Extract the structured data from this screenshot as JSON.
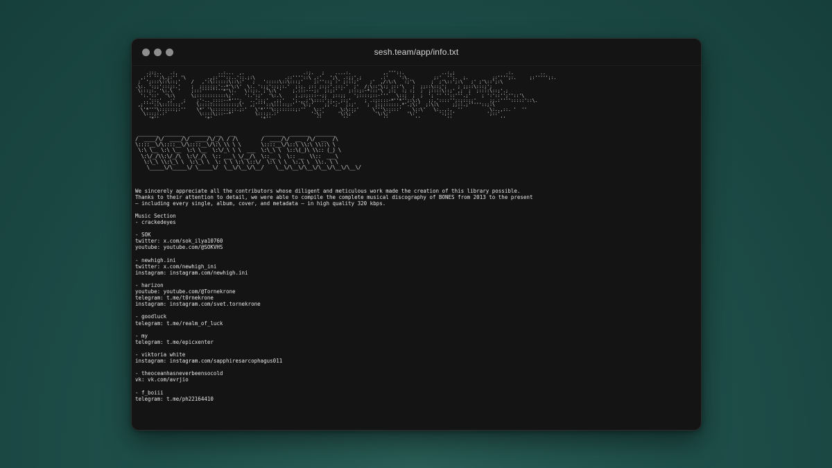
{
  "window": {
    "title": "sesh.team/app/info.txt"
  },
  "ascii_art": {
    "logo_lines": [
      "    .;:;..   .:,               ..:...  ,.                      .:;.   ;    ....:.            ,.'''::.              ..:,;                   .:.          ..",
      "  ,:'' '':\\.;:'' '\\        .,;:'''::..'::.;:\\           .::''''::\\ ,:'   ';\\  .:;;'.;       .:'    ':\\.         ;:'  '':.  ;.         ;:'''';:.     ;:''''';:.",
      " ;  ';:::\\::\\::;'    /   ,':\\::::::\\::\\:'   ;   ':::::\\::\\:::;'    ;:''::; :' ;:::;'    ;'  ,/:\\:\\   :;'\\      ;  ;'\\::';:\\   ;' ;'\\::';:\\",
      ".\\:. ':;;':::;:.'    ;  ;::::;:'--*'\\:\\'  \\:. ':;;'::;::.'  ;:;. ;:: ;:;:'.:::.'  ;'  /:\\::'\\:; ;::'\\   ;  ;;::\\::;';    ; ;;::\\:::;';",
      " \\:::;:. '\\:.\\  '    ;:::''''''''*'\\:.   \\::;:. ;'\\:\\ '    ;.:::---;:  ;:;:' '  ;:::;:-*:::'\\  ;:;  :; :;  ;  ;::::\\::;' ,;  ;  ;::::\\::;'.;",
      "  ':.'::'  '\\:\\      \\;:::::::::::\\;'    ':.':;'  '\\:.\\     ;.;:;:::--;;  ;::;;   ';::::;::-'''   \\::;  ;  ;  '; '' ''::'''.;'    ; ':'::'';''::'\\",
      "   ..'::;'  ,;'   ;    ;'-.._::::--*''';   ..'::;'  ,;;'   ';.,.;'\\::::';:,. ;:;'     ; .:;::::-*''*'';:\\:\\   ;:,'::::'';:;:::;'     ;;.:'''':::::'::\\.",
      " ,;''''::\\::::::;'     \\::::::::::::::;\\'  ,;''''::\\:::::;:'  '\\:;'    ;;'.;'  ;:;'    ;  ;:;::::::.*'.;\\:'  ;:\\:\\     ;;::.;'''''::;:\\",
      "  \\'*'''\\::::::;:''    \\*' '\\:::::::::.;:'   \\'*'''\\::::::::;:''   \\::'      \\:\\::;'     \\'''\\:::::'    \\::\\'   \\:..,:,  ''          \\:..,::. '  ''",
      "   \\:::;:.:'            \\::::\\;::--*'        \\:::;:.:'            '-\\;'     '\\:\\;'        '\\:\\;'      '\\:'        ':;::'            ';::'",
      "     '*''                 '*'                  '*''                 ''        ''             ''          ''          ''                  ''"
    ],
    "banner_lines": [
      " _______  _______  _______  __   __          _______  _______  _______ ",
      "/  ____/\\/  ____/\\/  ____/\\/_/\\ / /\\        /  ____/\\/  __  /\\/  __  /\\",
      "\\::::__\\/\\::::__\\/\\::::__\\/\\:\\ \\\\ \\ \\       \\::::__\\/\\::\\ \\\\:\\ \\\\::\\ \\",
      " \\:\\ \\__ \\:\\ \\__  \\:\\ \\__  \\:\\/_\\ \\ \\  ___  \\:\\_\\ \\  \\::\\(_)\\ \\\\:: (_) \\",
      "  \\:\\/_/\\\\:\\/_/\\  \\:\\/_/\\  \\:: ___\\ \\/__/\\  \\::__ \\  \\:: __  \\\\::  ___\\",
      "   \\:\\_\\ \\\\:\\_\\ \\  \\:\\_\\ \\  \\: \\ \\ \\:\\ \\::\\/  \\:\\ \\ \\  \\:.\\ \\  \\\\:. \\ \\",
      "    \\_____\\/\\_____\\/ \\_____\\/  \\__\\/\\__\\/\\__/    \\__\\/\\__\\/\\__\\/\\__\\/\\__\\/\\__\\/"
    ]
  },
  "info_lines": [
    "We sincerely appreciate all the contributors whose diligent and meticulous work made the creation of this library possible.",
    "Thanks to their attention to detail, we were able to compile the complete musical discography of BONES from 2013 to the present",
    "— including every single, album, cover, and metadata — in high quality 320 kbps.",
    "",
    "Music Section",
    "- crackedeyes",
    "",
    "- SOK",
    "twitter: x.com/sok_ilya10760",
    "youtube: youtube.com/@SOKVHS",
    "",
    "- newhigh.ini",
    "twitter: x.com/newhigh_ini",
    "instagram: instagram.com/newhigh.ini",
    "",
    "- harizon",
    "youtube: youtube.com/@Tornekrone",
    "telegram: t.me/t0rnekrone",
    "instagram: instagram.com/svet.tornekrone",
    "",
    "- goodluck",
    "telegram: t.me/realm_of_luck",
    "",
    "- my",
    "telegram: t.me/epicxenter",
    "",
    "- viktoria white",
    "instagram: instagram.com/sapphiresarcophagus011",
    "",
    "- theoceanhasneverbeensocold",
    "vk: vk.com/avrjio",
    "",
    "- f_boiii",
    "telegram: t.me/ph22164410"
  ]
}
